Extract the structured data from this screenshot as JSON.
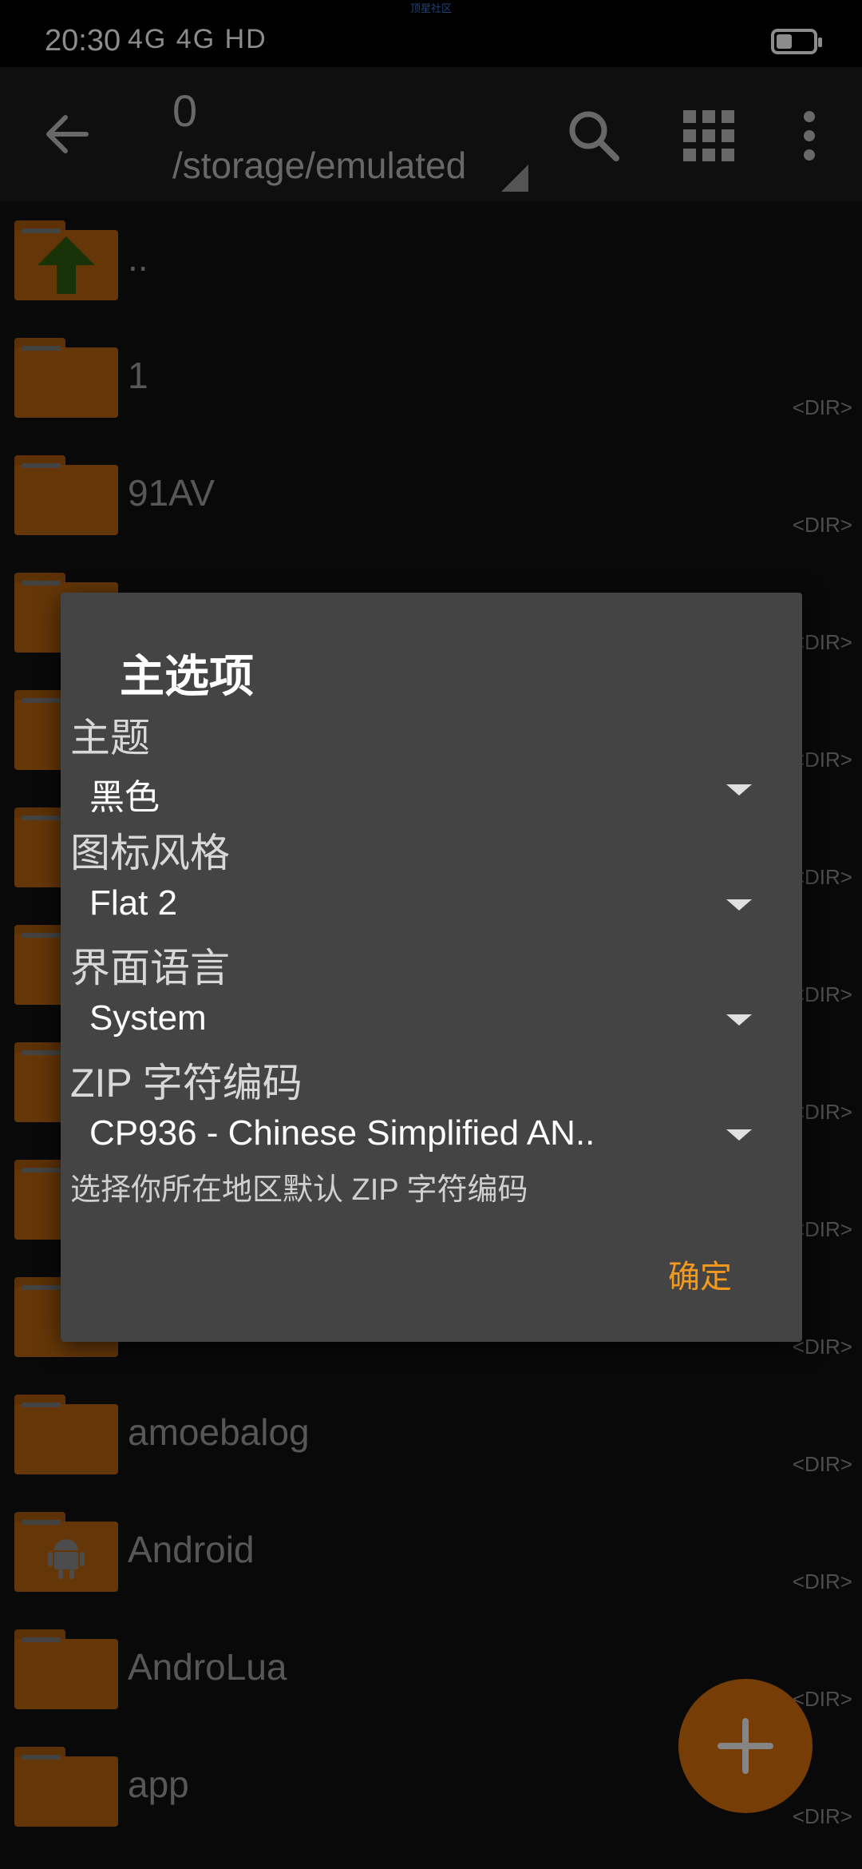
{
  "statusbar": {
    "time": "20:30",
    "indicators": "4G 4G  HD",
    "watermark": "顶星社区"
  },
  "toolbar": {
    "title": "0",
    "path": "/storage/emulated",
    "icons": [
      "back-arrow-icon",
      "search-icon",
      "grid-view-icon",
      "more-vert-icon"
    ]
  },
  "files": [
    {
      "name": "..",
      "tag": "",
      "icon": "up-arrow-icon"
    },
    {
      "name": "1",
      "tag": "<DIR>",
      "icon": ""
    },
    {
      "name": "91AV",
      "tag": "<DIR>",
      "icon": ""
    },
    {
      "name": "",
      "tag": "<DIR>",
      "icon": ""
    },
    {
      "name": "",
      "tag": "<DIR>",
      "icon": ""
    },
    {
      "name": "",
      "tag": "<DIR>",
      "icon": ""
    },
    {
      "name": "",
      "tag": "<DIR>",
      "icon": ""
    },
    {
      "name": "",
      "tag": "<DIR>",
      "icon": ""
    },
    {
      "name": "",
      "tag": "<DIR>",
      "icon": ""
    },
    {
      "name": "",
      "tag": "<DIR>",
      "icon": ""
    },
    {
      "name": "amoebalog",
      "tag": "<DIR>",
      "icon": ""
    },
    {
      "name": "Android",
      "tag": "<DIR>",
      "icon": "android-icon"
    },
    {
      "name": "AndroLua",
      "tag": "<DIR>",
      "icon": ""
    },
    {
      "name": "app",
      "tag": "<DIR>",
      "icon": ""
    }
  ],
  "dialog": {
    "title": "主选项",
    "theme_label": "主题",
    "theme_value": "黑色",
    "icon_style_label": "图标风格",
    "icon_style_value": "Flat 2",
    "language_label": "界面语言",
    "language_value": "System",
    "zip_label": "ZIP 字符编码",
    "zip_value": "CP936 - Chinese Simplified AN..",
    "zip_hint": "选择你所在地区默认 ZIP 字符编码",
    "ok_button": "确定"
  },
  "colors": {
    "accent": "#f39a1e",
    "folder": "#b8650f",
    "fab": "#d9700e"
  }
}
